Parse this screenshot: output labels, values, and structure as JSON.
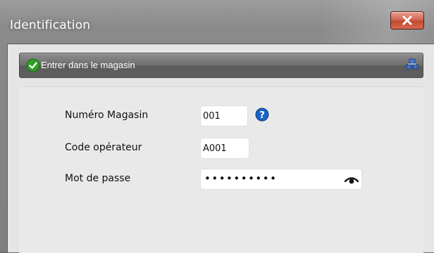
{
  "window": {
    "title": "Identification",
    "close_label": "X"
  },
  "panel": {
    "header_title": "Entrer dans le magasin",
    "header_icon": "check-circle-icon",
    "network_icon": "network-icon"
  },
  "form": {
    "store_number": {
      "label": "Numéro Magasin",
      "value": "001",
      "help_icon": "help-icon"
    },
    "operator_code": {
      "label": "Code opérateur",
      "value": "A001"
    },
    "password": {
      "label": "Mot de passe",
      "value": "••••••••••",
      "reveal_icon": "eye-icon"
    }
  },
  "colors": {
    "close_red": "#c24a33",
    "header_gray": "#6e6e6e",
    "check_green": "#2f9e24",
    "help_blue": "#1b63c6"
  }
}
